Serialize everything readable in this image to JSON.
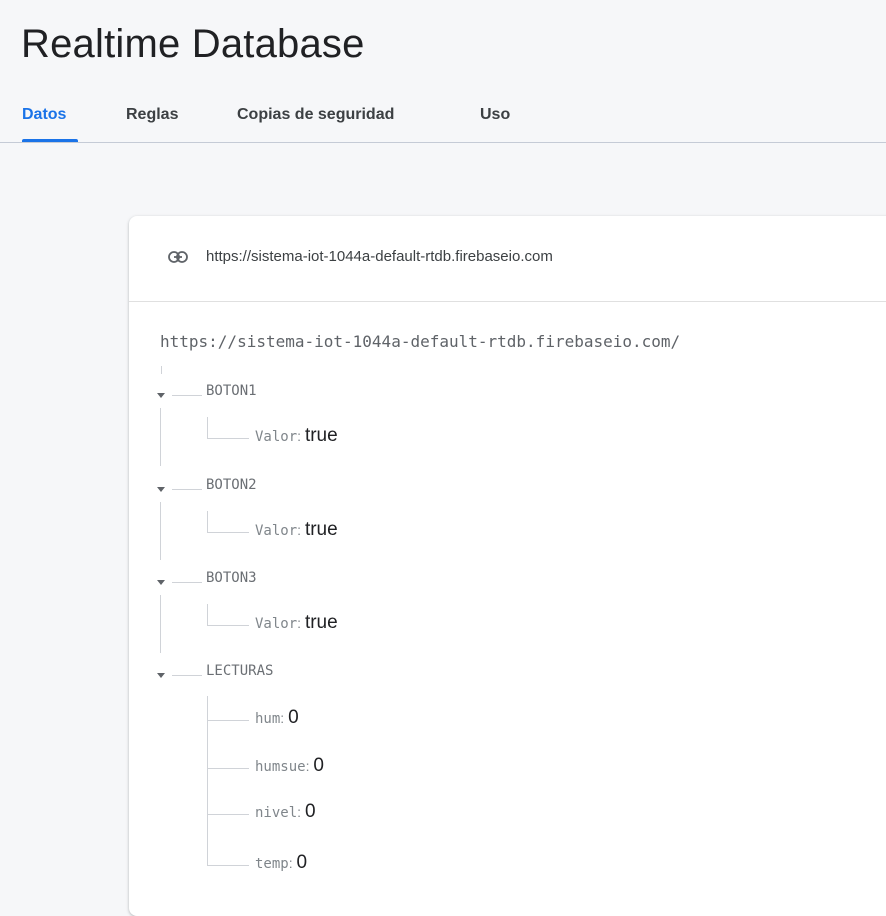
{
  "header": {
    "title": "Realtime Database"
  },
  "tabs": [
    {
      "label": "Datos",
      "active": true
    },
    {
      "label": "Reglas"
    },
    {
      "label": "Copias de seguridad"
    },
    {
      "label": "Uso"
    }
  ],
  "card": {
    "link_icon": "link-icon",
    "url": "https://sistema-iot-1044a-default-rtdb.firebaseio.com",
    "root": "https://sistema-iot-1044a-default-rtdb.firebaseio.com/"
  },
  "tree": [
    {
      "key": "BOTON1",
      "children": [
        {
          "key": "Valor",
          "sep": ": ",
          "value": "true"
        }
      ]
    },
    {
      "key": "BOTON2",
      "children": [
        {
          "key": "Valor",
          "sep": ": ",
          "value": "true"
        }
      ]
    },
    {
      "key": "BOTON3",
      "children": [
        {
          "key": "Valor",
          "sep": ": ",
          "value": "true"
        }
      ]
    },
    {
      "key": "LECTURAS",
      "children": [
        {
          "key": "hum",
          "sep": ": ",
          "value": "0"
        },
        {
          "key": "humsue",
          "sep": ": ",
          "value": "0"
        },
        {
          "key": "nivel",
          "sep": ": ",
          "value": "0"
        },
        {
          "key": "temp",
          "sep": ": ",
          "value": "0"
        }
      ]
    }
  ],
  "colors": {
    "accent": "#1a73e8"
  }
}
